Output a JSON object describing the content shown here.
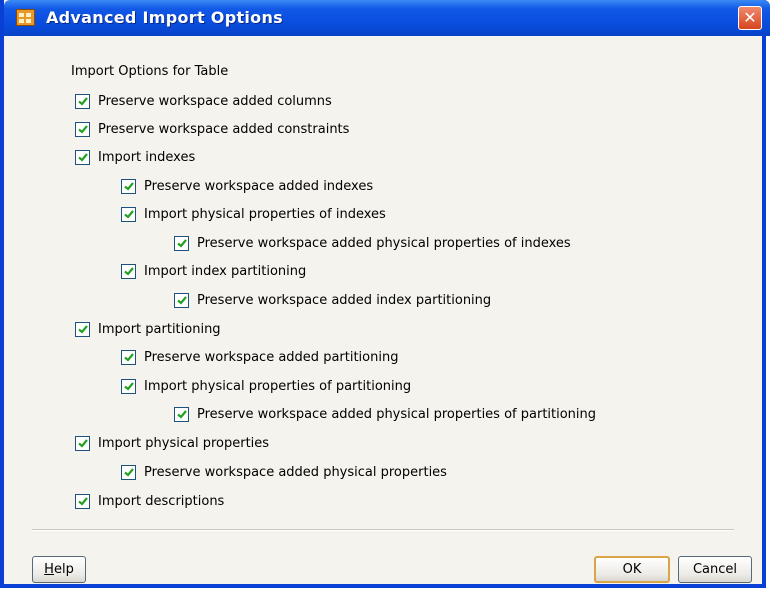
{
  "window": {
    "title": "Advanced Import Options",
    "close_symbol": "✕"
  },
  "section_label": "Import Options for Table",
  "options": [
    {
      "label": "Preserve workspace added columns",
      "checked": true
    },
    {
      "label": "Preserve workspace added constraints",
      "checked": true
    },
    {
      "label": "Import indexes",
      "checked": true
    },
    {
      "label": "Preserve workspace added indexes",
      "checked": true
    },
    {
      "label": "Import physical properties of indexes",
      "checked": true
    },
    {
      "label": "Preserve workspace added physical properties of indexes",
      "checked": true
    },
    {
      "label": "Import index partitioning",
      "checked": true
    },
    {
      "label": "Preserve workspace added index partitioning",
      "checked": true
    },
    {
      "label": "Import partitioning",
      "checked": true
    },
    {
      "label": "Preserve workspace added partitioning",
      "checked": true
    },
    {
      "label": "Import physical properties of partitioning",
      "checked": true
    },
    {
      "label": "Preserve workspace added physical properties of partitioning",
      "checked": true
    },
    {
      "label": "Import physical properties",
      "checked": true
    },
    {
      "label": "Preserve workspace added physical properties",
      "checked": true
    },
    {
      "label": "Import descriptions",
      "checked": true
    }
  ],
  "buttons": {
    "help_first": "H",
    "help_rest": "elp",
    "ok": "OK",
    "cancel": "Cancel"
  },
  "colors": {
    "check": "#21a121",
    "titlebar": "#0a4fe0"
  }
}
